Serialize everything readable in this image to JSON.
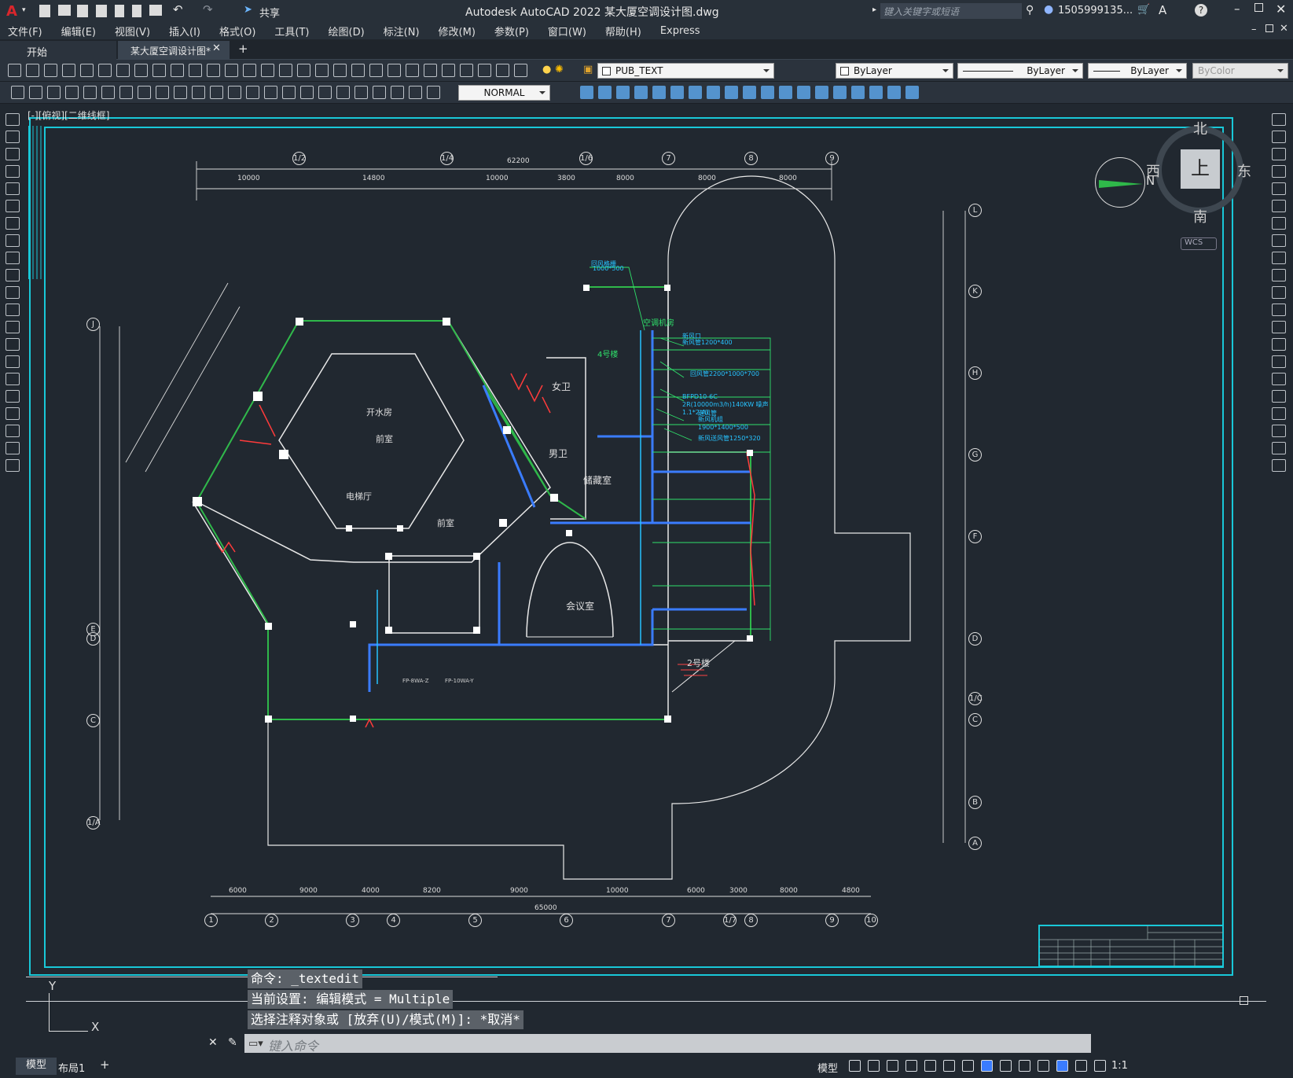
{
  "window": {
    "title": "Autodesk AutoCAD 2022    某大厦空调设计图.dwg",
    "share": "共享",
    "search_placeholder": "键入关键字或短语",
    "user": "1505999135..."
  },
  "menu": [
    "文件(F)",
    "编辑(E)",
    "视图(V)",
    "插入(I)",
    "格式(O)",
    "工具(T)",
    "绘图(D)",
    "标注(N)",
    "修改(M)",
    "参数(P)",
    "窗口(W)",
    "帮助(H)",
    "Express"
  ],
  "tabs": {
    "start": "开始",
    "drawing": "某大厦空调设计图*"
  },
  "toolbar": {
    "layer": "PUB_TEXT",
    "color": "ByLayer",
    "linetype": "ByLayer",
    "lineweight": "ByLayer",
    "plotstyle": "ByColor",
    "dimstyle": "NORMAL"
  },
  "viewport": {
    "label": "[-][俯视][二维线框]"
  },
  "viewcube": {
    "north": "北",
    "south": "南",
    "east": "东",
    "west": "西",
    "top": "上",
    "wcs": "WCS",
    "n": "N"
  },
  "drawing": {
    "top_axes": [
      "1/2",
      "1/4",
      "1/6",
      "7",
      "8",
      "9"
    ],
    "top_dims": [
      "10000",
      "14800",
      "10000",
      "3800",
      "8000",
      "8000",
      "8000"
    ],
    "top_total": "62200",
    "bottom_axes": [
      "1",
      "2",
      "3",
      "4",
      "5",
      "6",
      "7",
      "1/7",
      "8",
      "9",
      "10"
    ],
    "bottom_dims": [
      "6000",
      "9000",
      "4000",
      "8200",
      "9000",
      "10000",
      "6000",
      "3000",
      "8000",
      "4800"
    ],
    "bottom_total": "65000",
    "right_axes": [
      "L",
      "K",
      "H",
      "G",
      "F",
      "D",
      "1/C",
      "C",
      "B",
      "A"
    ],
    "left_axes": [
      "J",
      "E",
      "D",
      "C",
      "1/A"
    ],
    "rooms": [
      "女卫",
      "男卫",
      "开水房",
      "前室",
      "电梯厅",
      "储藏室",
      "会议室",
      "前室",
      "2号楼",
      "4号楼",
      "空调机房"
    ],
    "labels": [
      "回风格栅",
      "新风口",
      "送风管",
      "FP-8WA-Z",
      "FP-10WA-Y"
    ],
    "annotations": [
      "新风管1200*400",
      "回风管2200*1000*700",
      "新风机组1900*1400*500",
      "新风送风管1250*320",
      "1000*500",
      "BFPD10-6C-2R(10000m3/h)140KW 噪声1.1*2(A)"
    ]
  },
  "command": {
    "line1": "命令: _textedit",
    "line2": "当前设置: 编辑模式 = Multiple",
    "line3": "选择注释对象或 [放弃(U)/模式(M)]: *取消*",
    "placeholder": "键入命令"
  },
  "status": {
    "model": "模型",
    "layout1": "布局1",
    "model_btn": "模型",
    "scale": "1:1"
  }
}
